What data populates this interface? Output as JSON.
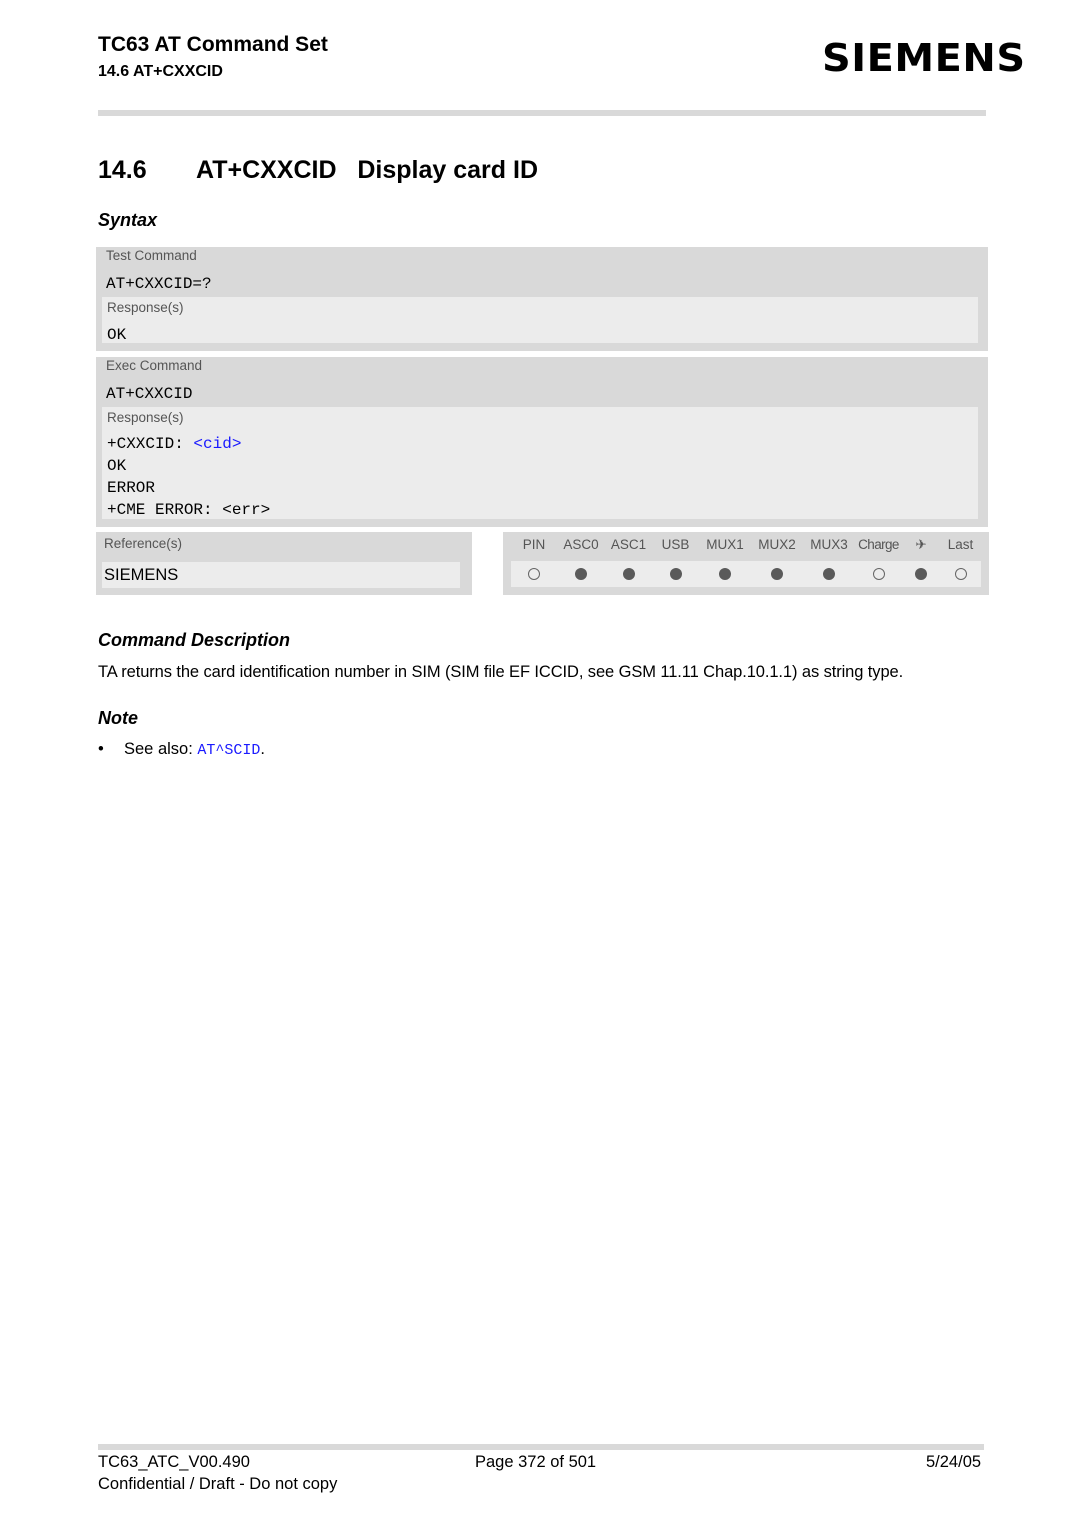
{
  "header": {
    "title": "TC63 AT Command Set",
    "section": "14.6 AT+CXXCID",
    "logo": "SIEMENS"
  },
  "heading": {
    "number": "14.6",
    "text": "AT+CXXCID   Display card ID"
  },
  "syntax": {
    "title": "Syntax",
    "test": {
      "label": "Test Command",
      "command": "AT+CXXCID=?",
      "responses_label": "Response(s)",
      "responses": [
        "OK"
      ]
    },
    "exec": {
      "label": "Exec Command",
      "command": "AT+CXXCID",
      "responses_label": "Response(s)",
      "response_prefix": "+CXXCID: ",
      "response_param": "<cid>",
      "responses": [
        "OK",
        "ERROR",
        "+CME ERROR: <err>"
      ]
    },
    "references": {
      "label": "Reference(s)",
      "value": "SIEMENS"
    },
    "pin_table": {
      "columns": [
        {
          "label": "PIN",
          "icon": null,
          "value": "empty-circle"
        },
        {
          "label": "ASC0",
          "icon": null,
          "value": "filled-circle"
        },
        {
          "label": "ASC1",
          "icon": null,
          "value": "filled-circle"
        },
        {
          "label": "USB",
          "icon": null,
          "value": "filled-circle"
        },
        {
          "label": "MUX1",
          "icon": null,
          "value": "filled-circle"
        },
        {
          "label": "MUX2",
          "icon": null,
          "value": "filled-circle"
        },
        {
          "label": "MUX3",
          "icon": null,
          "value": "filled-circle"
        },
        {
          "label": "Charge",
          "icon": null,
          "value": "empty-circle"
        },
        {
          "label": "✈",
          "icon": "airplane-icon",
          "value": "filled-circle"
        },
        {
          "label": "Last",
          "icon": null,
          "value": "empty-circle"
        }
      ]
    }
  },
  "description": {
    "title": "Command Description",
    "text": "TA returns the card identification number in SIM (SIM file EF ICCID, see GSM 11.11 Chap.10.1.1) as string type."
  },
  "note": {
    "title": "Note",
    "bullet": "•",
    "prefix": "See also: ",
    "link": "AT^SCID",
    "suffix": "."
  },
  "footer": {
    "doc_id": "TC63_ATC_V00.490",
    "page": "Page 372 of 501",
    "date": "5/24/05",
    "confidential": "Confidential / Draft - Do not copy"
  }
}
